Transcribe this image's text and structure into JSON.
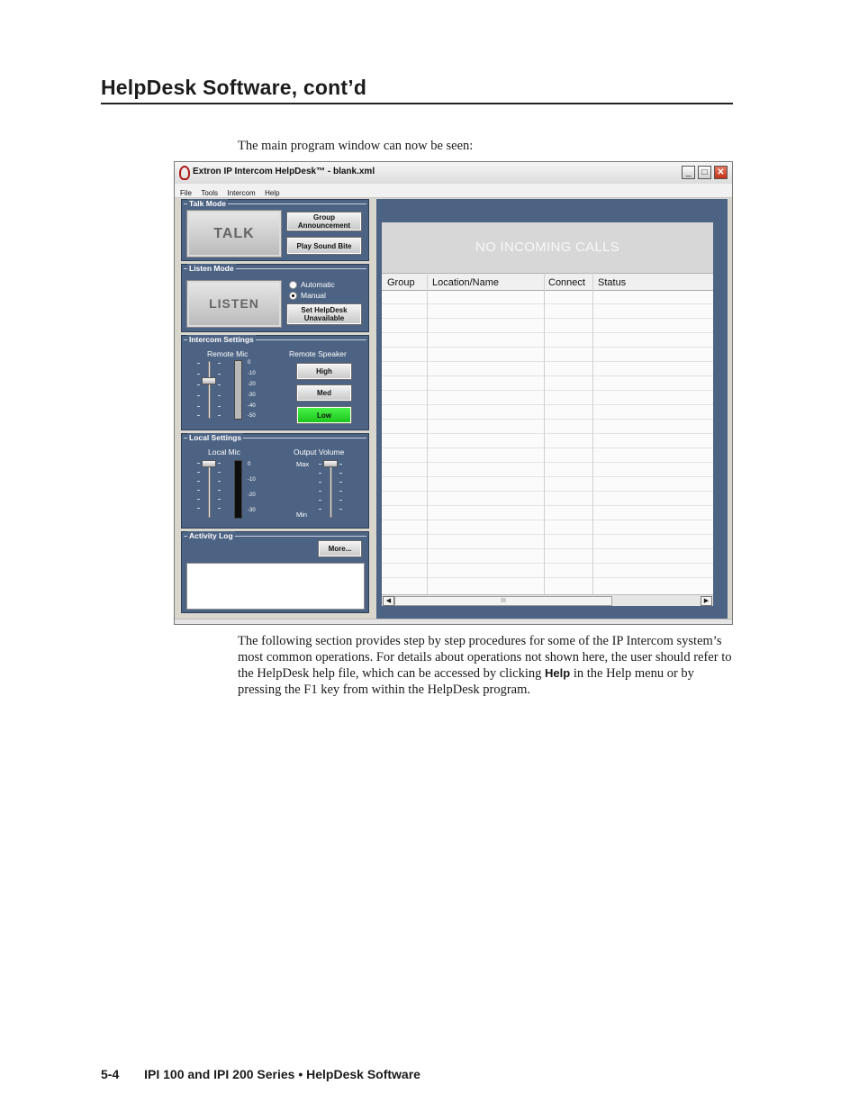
{
  "page": {
    "heading": "HelpDesk Software, cont’d",
    "intro": "The main program window can now be seen:",
    "body_1": "The following section provides step by step procedures for some of the IP Intercom system’s most common operations.  For details about operations not shown here, the user should refer to the HelpDesk help file, which can be accessed by clicking",
    "body_bold": "Help",
    "body_2": "in the Help menu or by pressing the F1 key from within the HelpDesk program.",
    "footer_page": "5-4",
    "footer_text": "IPI 100 and IPI 200 Series • HelpDesk Software"
  },
  "window": {
    "title": "Extron IP Intercom HelpDesk™ - blank.xml",
    "controls": {
      "minimize": "_",
      "maximize": "□",
      "close": "✕"
    },
    "menu": [
      "File",
      "Tools",
      "Intercom",
      "Help"
    ]
  },
  "talk_mode": {
    "label": "Talk Mode",
    "talk_button": "TALK",
    "group_line1": "Group",
    "group_line2": "Announcement",
    "play_sound": "Play Sound Bite"
  },
  "listen_mode": {
    "label": "Listen Mode",
    "listen_button": "LISTEN",
    "automatic": "Automatic",
    "manual": "Manual",
    "selected": "Manual",
    "set_line1": "Set HelpDesk",
    "set_line2": "Unavailable"
  },
  "intercom_settings": {
    "label": "Intercom Settings",
    "remote_mic": "Remote Mic",
    "remote_speaker": "Remote Speaker",
    "scale": [
      "0",
      "-10",
      "-20",
      "-30",
      "-40",
      "-50"
    ],
    "high": "High",
    "med": "Med",
    "low": "Low",
    "active_level": "Low"
  },
  "local_settings": {
    "label": "Local Settings",
    "local_mic": "Local Mic",
    "output_volume": "Output Volume",
    "scale": [
      "0",
      "-10",
      "-20",
      "-30"
    ],
    "max": "Max",
    "min": "Min"
  },
  "activity_log": {
    "label": "Activity Log",
    "more": "More..."
  },
  "calls": {
    "banner": "NO INCOMING CALLS",
    "columns": [
      "Group",
      "Location/Name",
      "Connect",
      "Status"
    ],
    "scroll_thumb": "III"
  },
  "icons": {
    "app": "extron-logo-icon",
    "scroll_left": "arrow-left-icon",
    "scroll_right": "arrow-right-icon"
  },
  "colors": {
    "panel": "#4d6384",
    "low_active": "#2fdc2f"
  }
}
